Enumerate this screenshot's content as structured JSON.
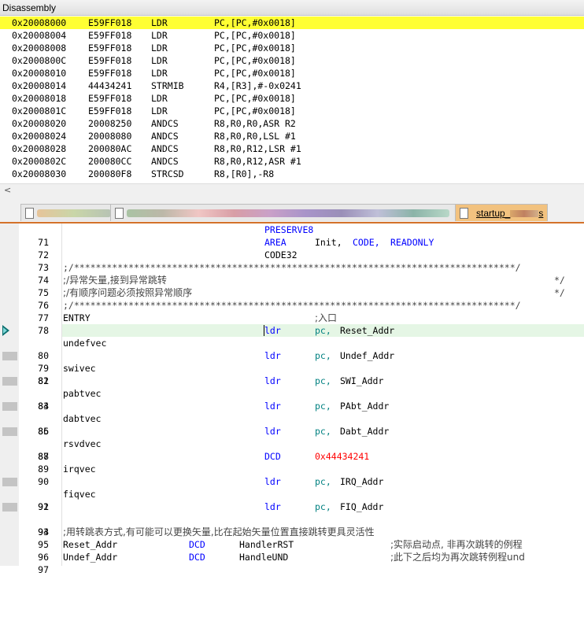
{
  "window_title": "Disassembly",
  "disassembly": [
    {
      "addr": "0x20008000",
      "code": "E59FF018",
      "mnemonic": "LDR",
      "operands": "PC,[PC,#0x0018]"
    },
    {
      "addr": "0x20008004",
      "code": "E59FF018",
      "mnemonic": "LDR",
      "operands": "PC,[PC,#0x0018]"
    },
    {
      "addr": "0x20008008",
      "code": "E59FF018",
      "mnemonic": "LDR",
      "operands": "PC,[PC,#0x0018]"
    },
    {
      "addr": "0x2000800C",
      "code": "E59FF018",
      "mnemonic": "LDR",
      "operands": "PC,[PC,#0x0018]"
    },
    {
      "addr": "0x20008010",
      "code": "E59FF018",
      "mnemonic": "LDR",
      "operands": "PC,[PC,#0x0018]"
    },
    {
      "addr": "0x20008014",
      "code": "44434241",
      "mnemonic": "STRMIB",
      "operands": "R4,[R3],#-0x0241"
    },
    {
      "addr": "0x20008018",
      "code": "E59FF018",
      "mnemonic": "LDR",
      "operands": "PC,[PC,#0x0018]"
    },
    {
      "addr": "0x2000801C",
      "code": "E59FF018",
      "mnemonic": "LDR",
      "operands": "PC,[PC,#0x0018]"
    },
    {
      "addr": "0x20008020",
      "code": "20008250",
      "mnemonic": "ANDCS",
      "operands": "R8,R0,R0,ASR R2"
    },
    {
      "addr": "0x20008024",
      "code": "20008080",
      "mnemonic": "ANDCS",
      "operands": "R8,R0,R0,LSL #1"
    },
    {
      "addr": "0x20008028",
      "code": "200080AC",
      "mnemonic": "ANDCS",
      "operands": "R8,R0,R12,LSR #1"
    },
    {
      "addr": "0x2000802C",
      "code": "200080CC",
      "mnemonic": "ANDCS",
      "operands": "R8,R0,R12,ASR #1"
    },
    {
      "addr": "0x20008030",
      "code": "200080F8",
      "mnemonic": "STRCSD",
      "operands": "R8,[R0],-R8"
    }
  ],
  "scroll_left_glyph": "<",
  "active_tab_label": "startup_",
  "active_tab_suffix": "s",
  "source": {
    "l71": {
      "n": "71",
      "kw": "PRESERVE8"
    },
    "l72": {
      "n": "72",
      "kw": "AREA",
      "name": "Init,",
      "code": "CODE,",
      "ro": "READONLY"
    },
    "l73": {
      "n": "73",
      "t": "CODE32"
    },
    "l74": {
      "n": "74",
      "t": ";/*********************************************************************************/"
    },
    "l75": {
      "n": "75",
      "t": ";/异常矢量,接到异常跳转",
      "end": "*/"
    },
    "l76": {
      "n": "76",
      "t": ";/有顺序问题必须按照异常顺序",
      "end": "*/"
    },
    "l77": {
      "n": "77",
      "t": ";/*********************************************************************************/"
    },
    "l78": {
      "n": "78",
      "label": "ENTRY",
      "cm": ";入口"
    },
    "l79": {
      "n": "79",
      "ins": "ldr",
      "reg": "pc,",
      "arg": "Reset_Addr"
    },
    "l80": {
      "n": "80",
      "label": "undefvec"
    },
    "l81": {
      "n": "81",
      "ins": "ldr",
      "reg": "pc,",
      "arg": "Undef_Addr"
    },
    "l82": {
      "n": "82",
      "label": "swivec"
    },
    "l83": {
      "n": "83",
      "ins": "ldr",
      "reg": "pc,",
      "arg": "SWI_Addr"
    },
    "l84": {
      "n": "84",
      "label": "pabtvec"
    },
    "l85": {
      "n": "85",
      "ins": "ldr",
      "reg": "pc,",
      "arg": "PAbt_Addr"
    },
    "l86": {
      "n": "86",
      "label": "dabtvec"
    },
    "l87": {
      "n": "87",
      "ins": "ldr",
      "reg": "pc,",
      "arg": "Dabt_Addr"
    },
    "l88": {
      "n": "88",
      "label": "rsvdvec"
    },
    "l89": {
      "n": "89",
      "ins": "DCD",
      "val": "0x44434241"
    },
    "l90": {
      "n": "90",
      "label": "irqvec"
    },
    "l91": {
      "n": "91",
      "ins": "ldr",
      "reg": "pc,",
      "arg": "IRQ_Addr"
    },
    "l92": {
      "n": "92",
      "label": "fiqvec"
    },
    "l93": {
      "n": "93",
      "ins": "ldr",
      "reg": "pc,",
      "arg": "FIQ_Addr"
    },
    "l94": {
      "n": "94"
    },
    "l95": {
      "n": "95",
      "t": ";用转跳表方式,有可能可以更换矢量,比在起始矢量位置直接跳转更具灵活性"
    },
    "l96": {
      "n": "96",
      "label": "Reset_Addr",
      "dcd": "DCD",
      "target": "HandlerRST",
      "cm": ";实际启动点, 非再次跳转的例程"
    },
    "l97": {
      "n": "97",
      "label": "Undef_Addr",
      "dcd": "DCD",
      "target": "HandleUND",
      "cm": ";此下之后均为再次跳转例程und"
    }
  },
  "colors": {
    "current_pc_highlight": "#ffff33",
    "current_line_highlight": "#e5f6e5",
    "keyword": "#0000ff",
    "register": "#008080",
    "number": "#ff0000",
    "active_tab": "#f2c27f",
    "tab_underline": "#d4722a"
  }
}
